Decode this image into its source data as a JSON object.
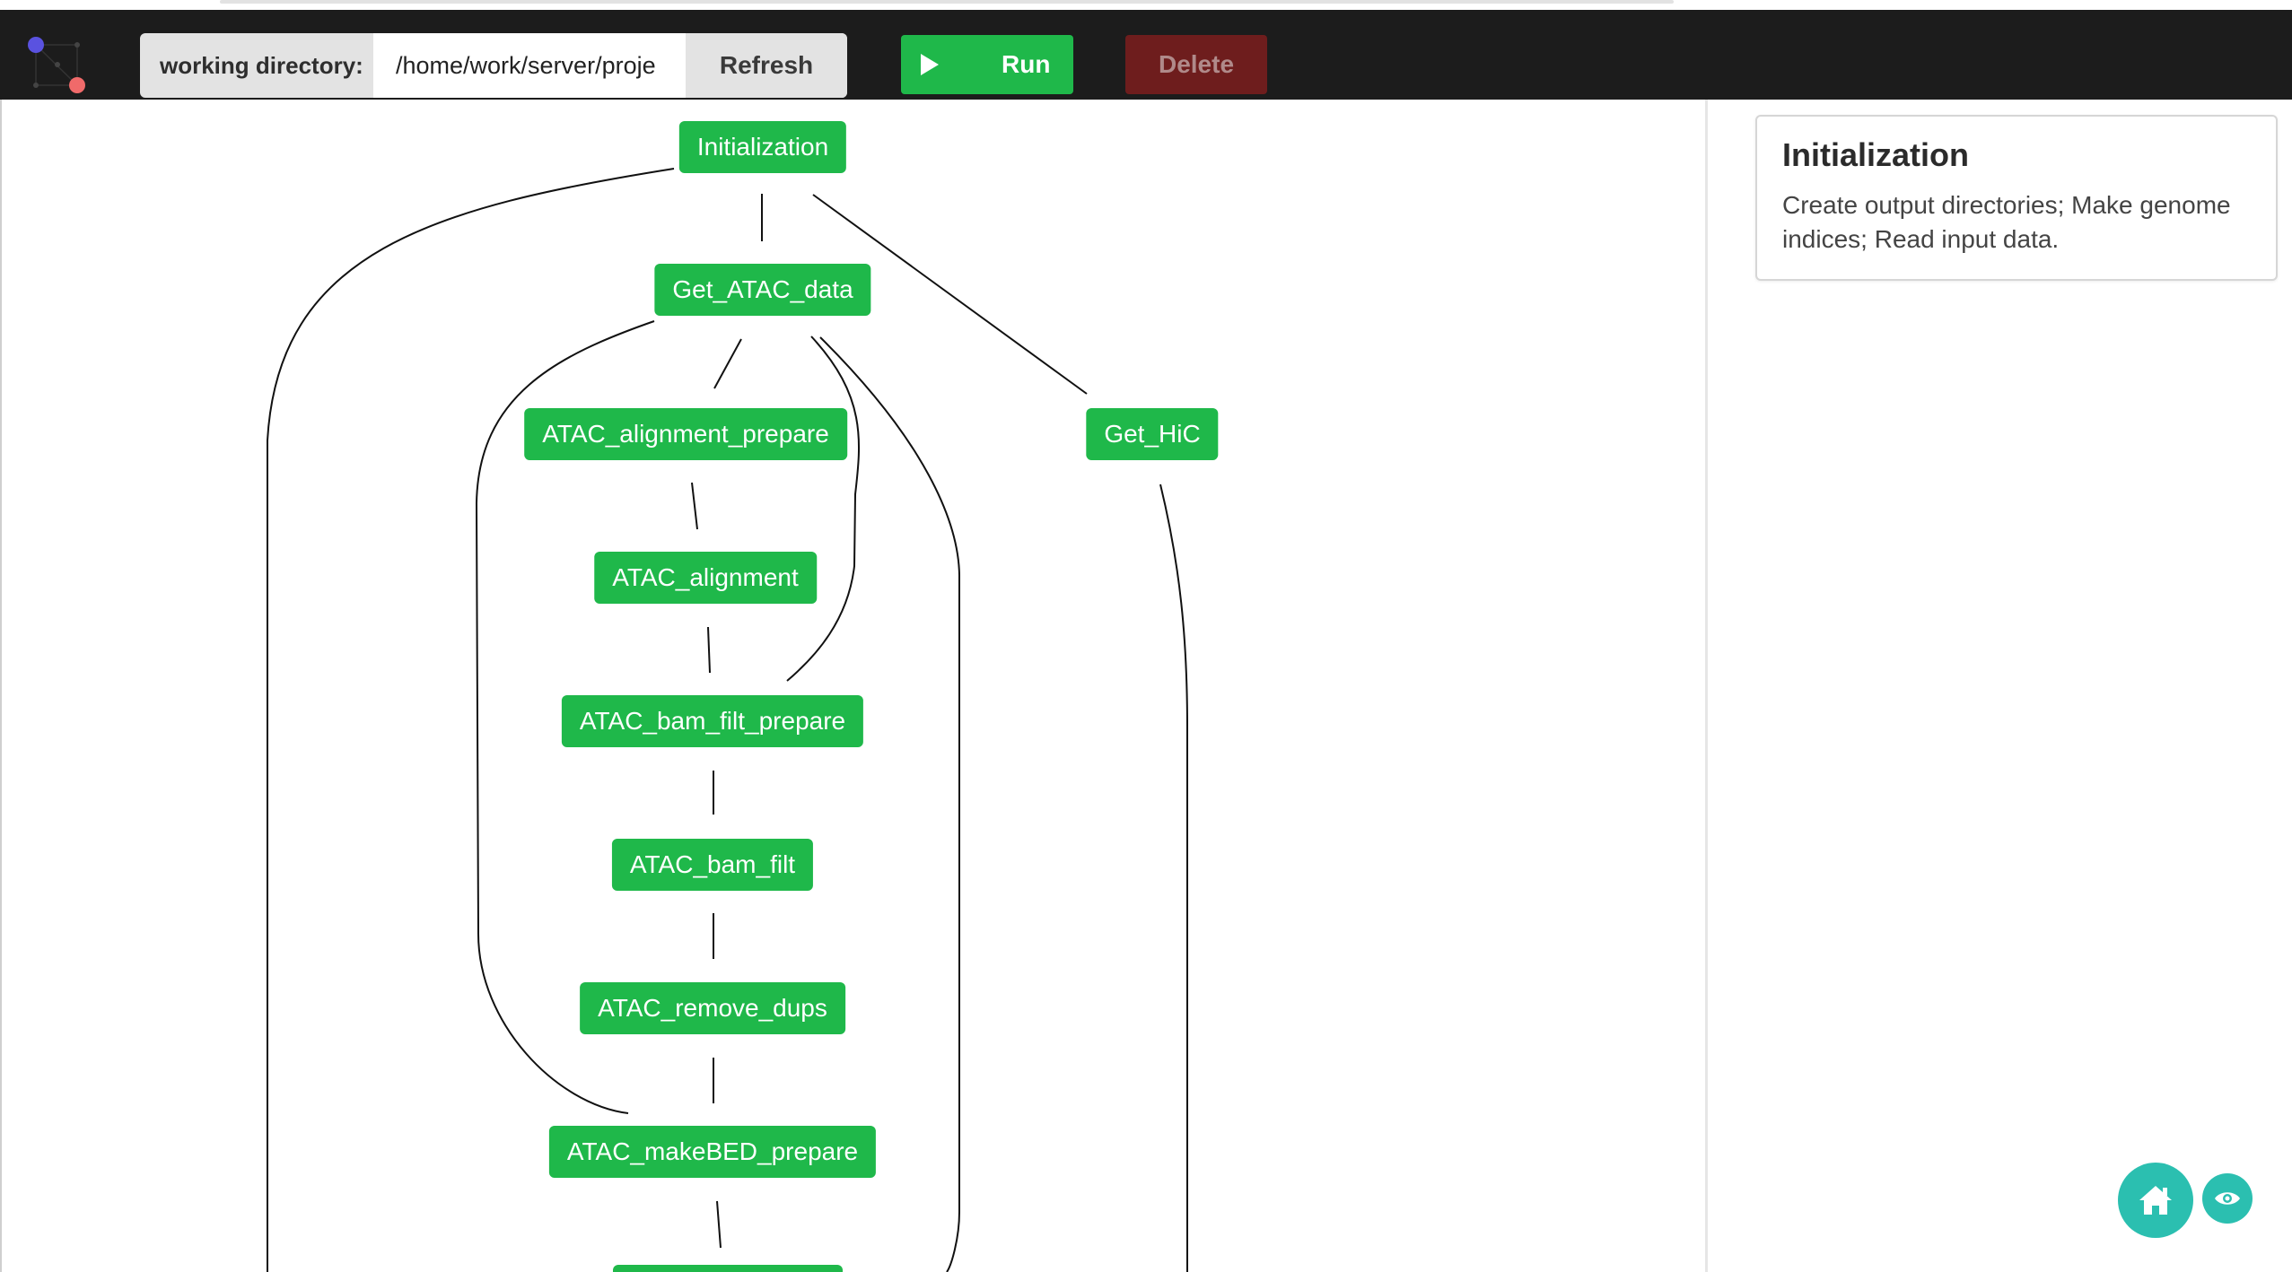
{
  "toolbar": {
    "logo_icon": "graph-logo-icon",
    "working_dir_label": "working directory:",
    "working_dir_value": "/home/work/server/proje",
    "refresh_label": "Refresh",
    "run_label": "Run",
    "delete_label": "Delete",
    "colors": {
      "run": "#1fb84a",
      "delete": "#6e1d1d",
      "bar": "#1c1c1c"
    }
  },
  "graph": {
    "nodes": [
      {
        "id": "initialization",
        "label": "Initialization"
      },
      {
        "id": "get-atac-data",
        "label": "Get_ATAC_data"
      },
      {
        "id": "atac-alignment-prepare",
        "label": "ATAC_alignment_prepare"
      },
      {
        "id": "get-hic",
        "label": "Get_HiC"
      },
      {
        "id": "atac-alignment",
        "label": "ATAC_alignment"
      },
      {
        "id": "atac-bam-filt-prepare",
        "label": "ATAC_bam_filt_prepare"
      },
      {
        "id": "atac-bam-filt",
        "label": "ATAC_bam_filt"
      },
      {
        "id": "atac-remove-dups",
        "label": "ATAC_remove_dups"
      },
      {
        "id": "atac-makebed-prepare",
        "label": "ATAC_makeBED_prepare"
      }
    ],
    "node_color": "#1fb84a"
  },
  "info_panel": {
    "title": "Initialization",
    "description": "Create output directories; Make genome indices; Read input data."
  },
  "fab": {
    "home_icon": "home-icon",
    "view_icon": "eye-icon",
    "color": "#2bbfb0"
  }
}
